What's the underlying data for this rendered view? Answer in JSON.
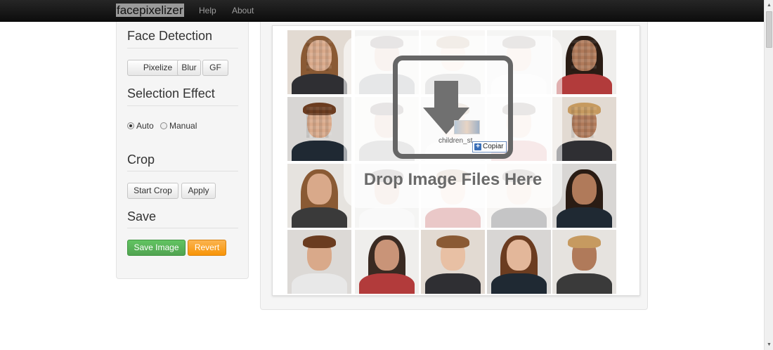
{
  "navbar": {
    "brand": "facepixelizer",
    "links": [
      "Help",
      "About"
    ]
  },
  "sidebar": {
    "face_detection": {
      "title": "Face Detection",
      "buttons": [
        "Pixelize",
        "Blur",
        "GF"
      ]
    },
    "selection_effect": {
      "title": "Selection Effect",
      "options": [
        "Auto",
        "Manual"
      ],
      "selected": "Auto"
    },
    "crop": {
      "title": "Crop",
      "buttons": [
        "Start Crop",
        "Apply"
      ]
    },
    "save": {
      "title": "Save",
      "save_label": "Save Image",
      "revert_label": "Revert"
    }
  },
  "main": {
    "drop_text": "Drop Image Files Here",
    "dragged_file_name": "children_st",
    "copy_tooltip": "Copiar"
  },
  "colors": {
    "save_button": "#5bb75b",
    "revert_button": "#faa732",
    "navbar": "#1b1b1b"
  }
}
